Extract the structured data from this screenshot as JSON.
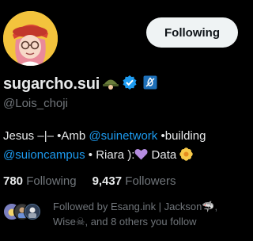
{
  "profile": {
    "display_name": "sugarcho.sui",
    "handle": "@Lois_choji",
    "bio": {
      "part1": "Jesus –|– •Amb ",
      "link1": "@suinetwork",
      "part2": " •building ",
      "link2": "@suioncampus",
      "part3": " • Riara ):",
      "part4": " Data "
    },
    "following_count": "780",
    "following_label": "Following",
    "followers_count": "9,437",
    "followers_label": "Followers"
  },
  "actions": {
    "follow_label": "Following"
  },
  "followed_by": {
    "text": "Followed by Esang.ink | Jackson🦈, Wise☠, and 8 others you follow"
  },
  "colors": {
    "background": "#000000",
    "link": "#1d9bf0",
    "muted": "#71767b",
    "verified": "#1d9bf0",
    "button_bg": "#eff3f4"
  },
  "icons": [
    "helmet-emoji-icon",
    "verified-badge-icon",
    "affiliate-badge-icon",
    "purple-heart-icon",
    "blossom-icon"
  ]
}
